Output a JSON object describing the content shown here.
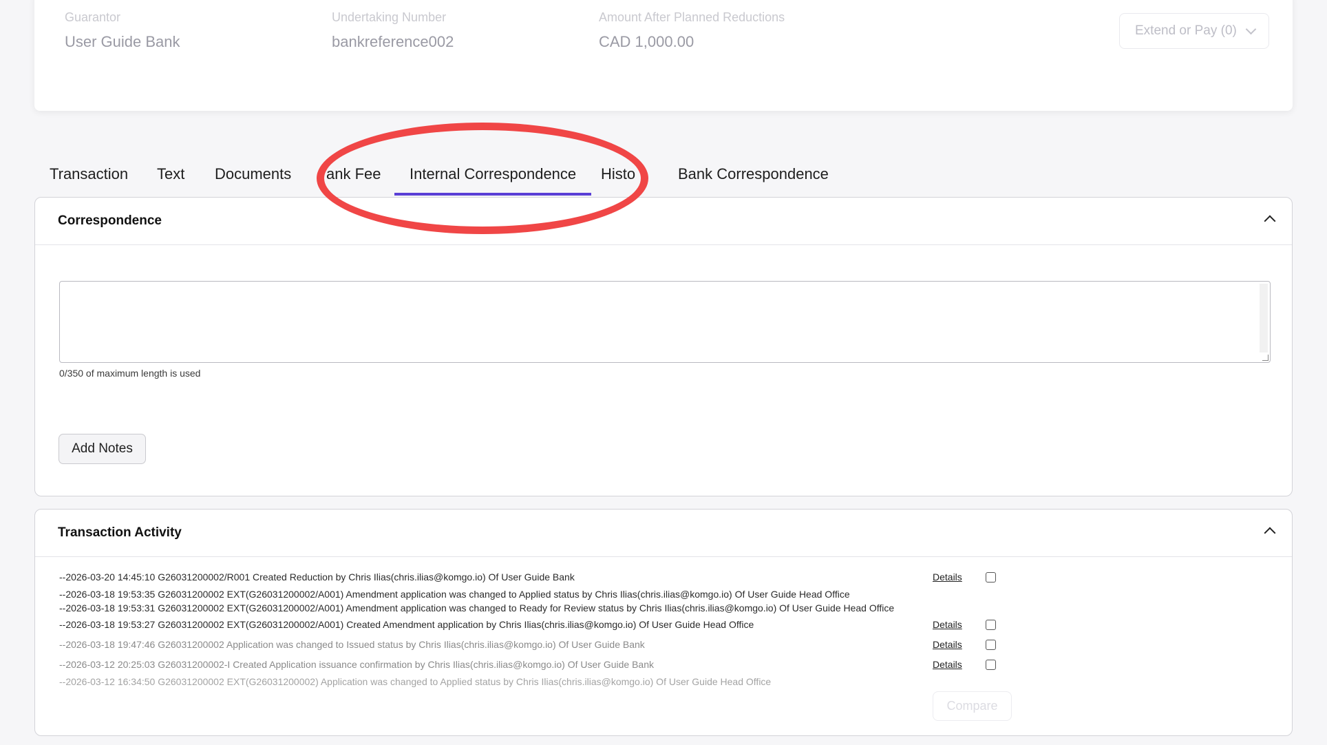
{
  "header": {
    "guarantor": {
      "label": "Guarantor",
      "value": "User Guide Bank"
    },
    "undertaking_number": {
      "label": "Undertaking Number",
      "value": "bankreference002"
    },
    "amount": {
      "label": "Amount After Planned Reductions",
      "value": "CAD 1,000.00"
    },
    "extend_button": "Extend or Pay (0)"
  },
  "tabs": [
    {
      "label": "Transaction",
      "active": false
    },
    {
      "label": "Text",
      "active": false
    },
    {
      "label": "Documents",
      "active": false
    },
    {
      "label": "ank Fee",
      "active": false
    },
    {
      "label": "Internal Correspondence",
      "active": true
    },
    {
      "label": "Histo",
      "active": false
    },
    {
      "label": "Bank Correspondence",
      "active": false
    }
  ],
  "correspondence": {
    "title": "Correspondence",
    "textarea_value": "",
    "counter": "0/350 of maximum length is used",
    "add_notes_button": "Add Notes"
  },
  "activity": {
    "title": "Transaction Activity",
    "details_label": "Details",
    "compare_button": "Compare",
    "rows": [
      {
        "text": "--2026-03-20 14:45:10 G26031200002/R001 Created Reduction by Chris Ilias(chris.ilias@komgo.io) Of User Guide Bank",
        "has_details": true
      },
      {
        "text": "--2026-03-18 19:53:35 G26031200002 EXT(G26031200002/A001) Amendment application was changed to Applied status by Chris Ilias(chris.ilias@komgo.io) Of User Guide Head Office",
        "has_details": false
      },
      {
        "text": "--2026-03-18 19:53:31 G26031200002 EXT(G26031200002/A001) Amendment application was changed to Ready for Review status by Chris Ilias(chris.ilias@komgo.io) Of User Guide Head Office",
        "has_details": false
      },
      {
        "text": "--2026-03-18 19:53:27 G26031200002 EXT(G26031200002/A001) Created Amendment application by Chris Ilias(chris.ilias@komgo.io) Of User Guide Head Office",
        "has_details": true
      },
      {
        "text": "--2026-03-18 19:47:46 G26031200002 Application was changed to Issued status by Chris Ilias(chris.ilias@komgo.io) Of User Guide Bank",
        "has_details": true
      },
      {
        "text": "--2026-03-12 20:25:03 G26031200002-I Created Application issuance confirmation by Chris Ilias(chris.ilias@komgo.io) Of User Guide Bank",
        "has_details": true
      },
      {
        "text": "--2026-03-12 16:34:50 G26031200002 EXT(G26031200002) Application was changed to Applied status by Chris Ilias(chris.ilias@komgo.io) Of User Guide Head Office",
        "has_details": false
      }
    ]
  }
}
